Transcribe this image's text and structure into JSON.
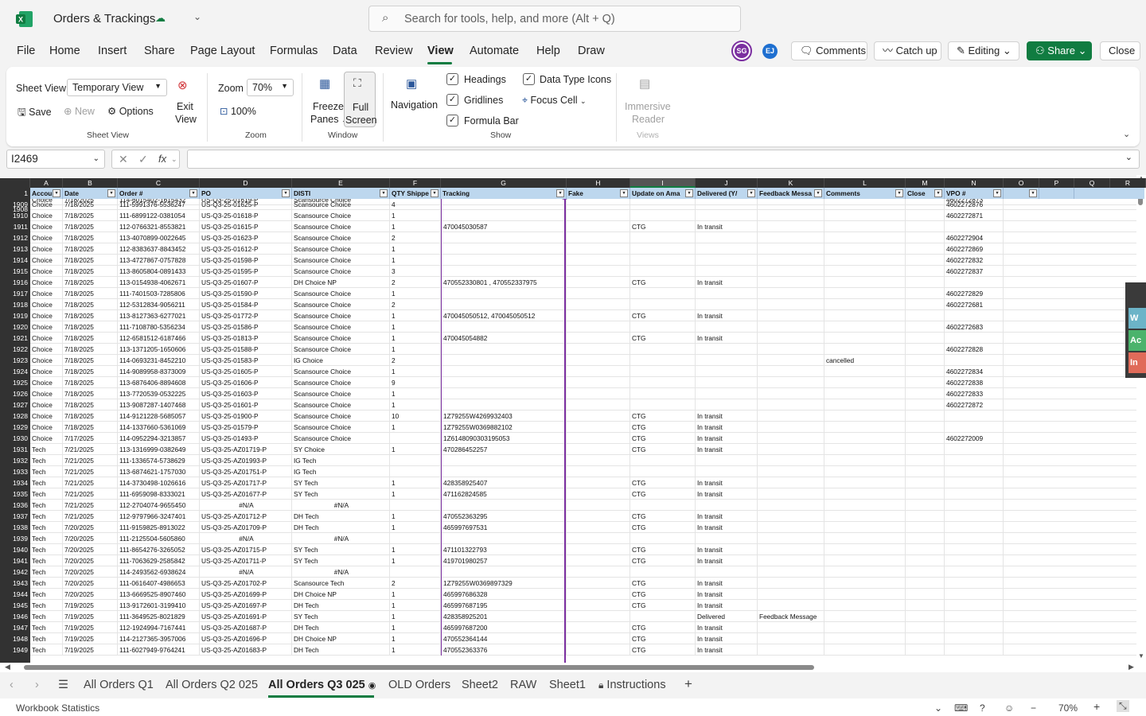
{
  "app": {
    "title": "Orders & Trackings",
    "search_placeholder": "Search for tools, help, and more (Alt + Q)"
  },
  "menu": [
    "File",
    "Home",
    "Insert",
    "Share",
    "Page Layout",
    "Formulas",
    "Data",
    "Review",
    "View",
    "Automate",
    "Help",
    "Draw"
  ],
  "menu_active": "View",
  "header_buttons": {
    "avatar1": "SG",
    "avatar2": "EJ",
    "comments": "Comments",
    "catchup": "Catch up",
    "editing": "Editing",
    "share": "Share",
    "close": "Close"
  },
  "ribbon": {
    "sheet_view_label": "Sheet View",
    "sheet_view_value": "Temporary View",
    "save": "Save",
    "new": "New",
    "options": "Options",
    "exit_view_1": "Exit",
    "exit_view_2": "View",
    "group_sheet_view": "Sheet View",
    "zoom_label": "Zoom",
    "zoom_value": "70%",
    "zoom_100": "100%",
    "group_zoom": "Zoom",
    "freeze_1": "Freeze",
    "freeze_2": "Panes",
    "full_1": "Full",
    "full_2": "Screen",
    "group_window": "Window",
    "navigation": "Navigation",
    "headings": "Headings",
    "gridlines": "Gridlines",
    "formula_bar": "Formula Bar",
    "data_type_icons": "Data Type Icons",
    "focus_cell": "Focus Cell",
    "group_show": "Show",
    "immersive_1": "Immersive",
    "immersive_2": "Reader",
    "group_views": "Views"
  },
  "formula_bar": {
    "name_box": "I2469",
    "fx": "fx",
    "value": ""
  },
  "columns": [
    "A",
    "B",
    "C",
    "D",
    "E",
    "F",
    "G",
    "H",
    "I",
    "J",
    "K",
    "L",
    "M",
    "N",
    "O",
    "P",
    "Q",
    "R"
  ],
  "selected_column": "I",
  "header_row_number": "1",
  "headers": [
    "Accou",
    "Date",
    "Order #",
    "PO",
    "DISTI",
    "QTY Shippe",
    "Tracking",
    "Fake",
    "Update on Ama",
    "Delivered (Y/",
    "Feedback Messa",
    "Comments",
    "Close",
    "VPO #",
    "",
    ""
  ],
  "partial_row": {
    "num": "1908",
    "cells": [
      "Choice",
      "7/18/2025",
      "114-6015402-1615432",
      "US-Q3-25-01619-P",
      "Scansource Choice",
      "",
      "",
      "",
      "",
      "",
      "",
      "",
      "",
      "4602272873"
    ]
  },
  "rows": [
    {
      "num": "1909",
      "cells": [
        "Choice",
        "7/18/2025",
        "111-5991376-5536247",
        "US-Q3-25-01625-P",
        "Scansource Choice",
        "4",
        "",
        "",
        "",
        "",
        "",
        "",
        "",
        "4602272876"
      ]
    },
    {
      "num": "1910",
      "cells": [
        "Choice",
        "7/18/2025",
        "111-6899122-0381054",
        "US-Q3-25-01618-P",
        "Scansource Choice",
        "1",
        "",
        "",
        "",
        "",
        "",
        "",
        "",
        "4602272871"
      ]
    },
    {
      "num": "1911",
      "cells": [
        "Choice",
        "7/18/2025",
        "112-0766321-8553821",
        "US-Q3-25-01615-P",
        "Scansource Choice",
        "1",
        "470045030587",
        "",
        "CTG",
        "In transit",
        "",
        "",
        "",
        ""
      ]
    },
    {
      "num": "1912",
      "cells": [
        "Choice",
        "7/18/2025",
        "113-4070899-0022645",
        "US-Q3-25-01623-P",
        "Scansource Choice",
        "2",
        "",
        "",
        "",
        "",
        "",
        "",
        "",
        "4602272904"
      ]
    },
    {
      "num": "1913",
      "cells": [
        "Choice",
        "7/18/2025",
        "112-8383637-8843452",
        "US-Q3-25-01612-P",
        "Scansource Choice",
        "1",
        "",
        "",
        "",
        "",
        "",
        "",
        "",
        "4602272869"
      ]
    },
    {
      "num": "1914",
      "cells": [
        "Choice",
        "7/18/2025",
        "113-4727867-0757828",
        "US-Q3-25-01598-P",
        "Scansource Choice",
        "1",
        "",
        "",
        "",
        "",
        "",
        "",
        "",
        "4602272832"
      ]
    },
    {
      "num": "1915",
      "cells": [
        "Choice",
        "7/18/2025",
        "113-8605804-0891433",
        "US-Q3-25-01595-P",
        "Scansource Choice",
        "3",
        "",
        "",
        "",
        "",
        "",
        "",
        "",
        "4602272837"
      ]
    },
    {
      "num": "1916",
      "cells": [
        "Choice",
        "7/18/2025",
        "113-0154938-4062671",
        "US-Q3-25-01607-P",
        "DH Choice NP",
        "2",
        "470552330801 , 470552337975",
        "",
        "CTG",
        "In transit",
        "",
        "",
        "",
        ""
      ]
    },
    {
      "num": "1917",
      "cells": [
        "Choice",
        "7/18/2025",
        "111-7401503-7285806",
        "US-Q3-25-01590-P",
        "Scansource Choice",
        "1",
        "",
        "",
        "",
        "",
        "",
        "",
        "",
        "4602272829"
      ]
    },
    {
      "num": "1918",
      "cells": [
        "Choice",
        "7/18/2025",
        "112-5312834-9056211",
        "US-Q3-25-01584-P",
        "Scansource Choice",
        "2",
        "",
        "",
        "",
        "",
        "",
        "",
        "",
        "4602272681"
      ]
    },
    {
      "num": "1919",
      "cells": [
        "Choice",
        "7/18/2025",
        "113-8127363-6277021",
        "US-Q3-25-01772-P",
        "Scansource Choice",
        "1",
        "470045050512, 470045050512",
        "",
        "CTG",
        "In transit",
        "",
        "",
        "",
        ""
      ]
    },
    {
      "num": "1920",
      "cells": [
        "Choice",
        "7/18/2025",
        "111-7108780-5356234",
        "US-Q3-25-01586-P",
        "Scansource Choice",
        "1",
        "",
        "",
        "",
        "",
        "",
        "",
        "",
        "4602272683"
      ]
    },
    {
      "num": "1921",
      "cells": [
        "Choice",
        "7/18/2025",
        "112-6581512-6187466",
        "US-Q3-25-01813-P",
        "Scansource Choice",
        "1",
        "470045054882",
        "",
        "CTG",
        "In transit",
        "",
        "",
        "",
        ""
      ]
    },
    {
      "num": "1922",
      "cells": [
        "Choice",
        "7/18/2025",
        "113-1371205-1650606",
        "US-Q3-25-01588-P",
        "Scansource Choice",
        "1",
        "",
        "",
        "",
        "",
        "",
        "",
        "",
        "4602272828"
      ]
    },
    {
      "num": "1923",
      "cells": [
        "Choice",
        "7/18/2025",
        "114-0693231-8452210",
        "US-Q3-25-01583-P",
        "IG Choice",
        "2",
        "",
        "",
        "",
        "",
        "",
        "cancelled",
        "",
        ""
      ]
    },
    {
      "num": "1924",
      "cells": [
        "Choice",
        "7/18/2025",
        "114-9089958-8373009",
        "US-Q3-25-01605-P",
        "Scansource Choice",
        "1",
        "",
        "",
        "",
        "",
        "",
        "",
        "",
        "4602272834"
      ]
    },
    {
      "num": "1925",
      "cells": [
        "Choice",
        "7/18/2025",
        "113-6876406-8894608",
        "US-Q3-25-01606-P",
        "Scansource Choice",
        "9",
        "",
        "",
        "",
        "",
        "",
        "",
        "",
        "4602272838"
      ]
    },
    {
      "num": "1926",
      "cells": [
        "Choice",
        "7/18/2025",
        "113-7720539-0532225",
        "US-Q3-25-01603-P",
        "Scansource Choice",
        "1",
        "",
        "",
        "",
        "",
        "",
        "",
        "",
        "4602272833"
      ]
    },
    {
      "num": "1927",
      "cells": [
        "Choice",
        "7/18/2025",
        "113-9087287-1407468",
        "US-Q3-25-01601-P",
        "Scansource Choice",
        "1",
        "",
        "",
        "",
        "",
        "",
        "",
        "",
        "4602272872"
      ]
    },
    {
      "num": "1928",
      "cells": [
        "Choice",
        "7/18/2025",
        "114-9121228-5685057",
        "US-Q3-25-01900-P",
        "Scansource Choice",
        "10",
        "1Z79255W4269932403",
        "",
        "CTG",
        "In transit",
        "",
        "",
        "",
        ""
      ]
    },
    {
      "num": "1929",
      "cells": [
        "Choice",
        "7/18/2025",
        "114-1337660-5361069",
        "US-Q3-25-01579-P",
        "Scansource Choice",
        "1",
        "1Z79255W0369882102",
        "",
        "CTG",
        "In transit",
        "",
        "",
        "",
        ""
      ]
    },
    {
      "num": "1930",
      "cells": [
        "Choice",
        "7/17/2025",
        "114-0952294-3213857",
        "US-Q3-25-01493-P",
        "Scansource Choice",
        "",
        "1Z6148090303195053",
        "",
        "CTG",
        "In transit",
        "",
        "",
        "",
        "4602272009"
      ]
    },
    {
      "num": "1931",
      "cells": [
        "Tech",
        "7/21/2025",
        "113-1316999-0382649",
        "US-Q3-25-AZ01719-P",
        "SY Choice",
        "1",
        "470286452257",
        "",
        "CTG",
        "In transit",
        "",
        "",
        "",
        ""
      ]
    },
    {
      "num": "1932",
      "cells": [
        "Tech",
        "7/21/2025",
        "111-1336574-5738629",
        "US-Q3-25-AZ01993-P",
        "IG Tech",
        "",
        "",
        "",
        "",
        "",
        "",
        "",
        "",
        ""
      ]
    },
    {
      "num": "1933",
      "cells": [
        "Tech",
        "7/21/2025",
        "113-6874621-1757030",
        "US-Q3-25-AZ01751-P",
        "IG Tech",
        "",
        "",
        "",
        "",
        "",
        "",
        "",
        "",
        ""
      ]
    },
    {
      "num": "1934",
      "cells": [
        "Tech",
        "7/21/2025",
        "114-3730498-1026616",
        "US-Q3-25-AZ01717-P",
        "SY Tech",
        "1",
        "428358925407",
        "",
        "CTG",
        "In transit",
        "",
        "",
        "",
        ""
      ]
    },
    {
      "num": "1935",
      "cells": [
        "Tech",
        "7/21/2025",
        "111-6959098-8333021",
        "US-Q3-25-AZ01677-P",
        "SY Tech",
        "1",
        "471162824585",
        "",
        "CTG",
        "In transit",
        "",
        "",
        "",
        ""
      ]
    },
    {
      "num": "1936",
      "cells": [
        "Tech",
        "7/21/2025",
        "112-2704074-9655450",
        "#N/A",
        "#N/A",
        "",
        "",
        "",
        "",
        "",
        "",
        "",
        "",
        ""
      ]
    },
    {
      "num": "1937",
      "cells": [
        "Tech",
        "7/21/2025",
        "112-9797966-3247401",
        "US-Q3-25-AZ01712-P",
        "DH Tech",
        "1",
        "470552363295",
        "",
        "CTG",
        "In transit",
        "",
        "",
        "",
        ""
      ]
    },
    {
      "num": "1938",
      "cells": [
        "Tech",
        "7/20/2025",
        "111-9159825-8913022",
        "US-Q3-25-AZ01709-P",
        "DH Tech",
        "1",
        "465997697531",
        "",
        "CTG",
        "In transit",
        "",
        "",
        "",
        ""
      ]
    },
    {
      "num": "1939",
      "cells": [
        "Tech",
        "7/20/2025",
        "111-2125504-5605860",
        "#N/A",
        "#N/A",
        "",
        "",
        "",
        "",
        "",
        "",
        "",
        "",
        ""
      ]
    },
    {
      "num": "1940",
      "cells": [
        "Tech",
        "7/20/2025",
        "111-8654276-3265052",
        "US-Q3-25-AZ01715-P",
        "SY Tech",
        "1",
        "471101322793",
        "",
        "CTG",
        "In transit",
        "",
        "",
        "",
        ""
      ]
    },
    {
      "num": "1941",
      "cells": [
        "Tech",
        "7/20/2025",
        "111-7063629-2585842",
        "US-Q3-25-AZ01711-P",
        "SY Tech",
        "1",
        "419701980257",
        "",
        "CTG",
        "In transit",
        "",
        "",
        "",
        ""
      ]
    },
    {
      "num": "1942",
      "cells": [
        "Tech",
        "7/20/2025",
        "114-2493562-6938624",
        "#N/A",
        "#N/A",
        "",
        "",
        "",
        "",
        "",
        "",
        "",
        "",
        ""
      ]
    },
    {
      "num": "1943",
      "cells": [
        "Tech",
        "7/20/2025",
        "111-0616407-4986653",
        "US-Q3-25-AZ01702-P",
        "Scansource Tech",
        "2",
        "1Z79255W0369897329",
        "",
        "CTG",
        "In transit",
        "",
        "",
        "",
        ""
      ]
    },
    {
      "num": "1944",
      "cells": [
        "Tech",
        "7/20/2025",
        "113-6669525-8907460",
        "US-Q3-25-AZ01699-P",
        "DH Choice NP",
        "1",
        "465997686328",
        "",
        "CTG",
        "In transit",
        "",
        "",
        "",
        ""
      ]
    },
    {
      "num": "1945",
      "cells": [
        "Tech",
        "7/19/2025",
        "113-9172601-3199410",
        "US-Q3-25-AZ01697-P",
        "DH Tech",
        "1",
        "465997687195",
        "",
        "CTG",
        "In transit",
        "",
        "",
        "",
        ""
      ]
    },
    {
      "num": "1946",
      "cells": [
        "Tech",
        "7/19/2025",
        "111-3649525-8021829",
        "US-Q3-25-AZ01691-P",
        "SY Tech",
        "1",
        "428358925201",
        "",
        "",
        "Delivered",
        "Feedback Message",
        "",
        "",
        ""
      ]
    },
    {
      "num": "1947",
      "cells": [
        "Tech",
        "7/19/2025",
        "112-1924994-7167441",
        "US-Q3-25-AZ01687-P",
        "DH Tech",
        "1",
        "465997687200",
        "",
        "CTG",
        "In transit",
        "",
        "",
        "",
        ""
      ]
    },
    {
      "num": "1948",
      "cells": [
        "Tech",
        "7/19/2025",
        "114-2127365-3957006",
        "US-Q3-25-AZ01696-P",
        "DH Choice NP",
        "1",
        "470552364144",
        "",
        "CTG",
        "In transit",
        "",
        "",
        "",
        ""
      ]
    },
    {
      "num": "1949",
      "cells": [
        "Tech",
        "7/19/2025",
        "111-6027949-9764241",
        "US-Q3-25-AZ01683-P",
        "DH Tech",
        "1",
        "470552363376",
        "",
        "CTG",
        "In transit",
        "",
        "",
        "",
        ""
      ]
    }
  ],
  "side_panel": [
    "W",
    "Ac",
    "In"
  ],
  "sheet_tabs": [
    "All Orders Q1",
    "All Orders Q2 025",
    "All Orders Q3 025",
    "OLD Orders",
    "Sheet2",
    "RAW",
    "Sheet1",
    "Instructions"
  ],
  "active_tab": "All Orders Q3 025",
  "status": {
    "left": "Workbook Statistics",
    "zoom": "70%"
  },
  "colors": {
    "excel_green": "#107c41",
    "header_fill": "#bdd7ee",
    "presence": "#7b2fa0"
  }
}
